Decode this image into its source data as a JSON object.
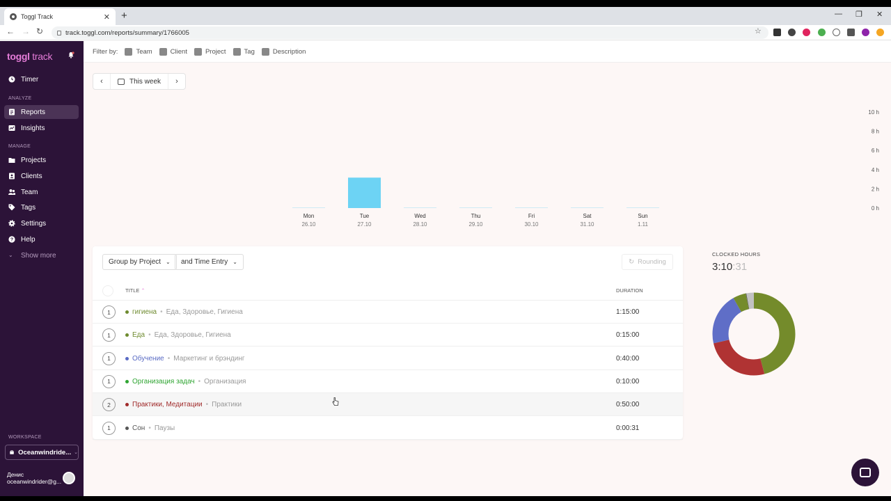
{
  "browser": {
    "tab_title": "Toggl Track",
    "url": "track.toggl.com/reports/summary/1766005"
  },
  "sidebar": {
    "logo_main": "toggl",
    "logo_sub": " track",
    "timer": "Timer",
    "analyze_label": "ANALYZE",
    "analyze": [
      "Reports",
      "Insights"
    ],
    "manage_label": "MANAGE",
    "manage": [
      "Projects",
      "Clients",
      "Team",
      "Tags",
      "Settings",
      "Help"
    ],
    "show_more": "Show more",
    "workspace_label": "WORKSPACE",
    "workspace": "Oceanwindride...",
    "user_name": "Денис",
    "user_email": "oceanwindrider@g..."
  },
  "filters": {
    "label": "Filter by:",
    "items": [
      "Team",
      "Client",
      "Project",
      "Tag",
      "Description"
    ]
  },
  "date_picker": {
    "label": "This week"
  },
  "chart_data": {
    "type": "bar",
    "categories": [
      "Mon",
      "Tue",
      "Wed",
      "Thu",
      "Fri",
      "Sat",
      "Sun"
    ],
    "dates": [
      "26.10",
      "27.10",
      "28.10",
      "29.10",
      "30.10",
      "31.10",
      "1.11"
    ],
    "values": [
      0,
      3.17,
      0,
      0,
      0,
      0,
      0
    ],
    "y_ticks": [
      "10 h",
      "8 h",
      "6 h",
      "4 h",
      "2 h",
      "0 h"
    ],
    "ylim": [
      0,
      10
    ],
    "bar_color": "#6dd3f4"
  },
  "table": {
    "group_by": "Group by Project",
    "sub_group": "and Time Entry",
    "rounding": "Rounding",
    "col_title": "TITLE",
    "col_duration": "DURATION",
    "rows": [
      {
        "count": "1",
        "project": "гигиена",
        "client": "Еда, Здоровье, Гигиена",
        "duration": "1:15:00",
        "color": "#6e8b2f"
      },
      {
        "count": "1",
        "project": "Еда",
        "client": "Еда, Здоровье, Гигиена",
        "duration": "0:15:00",
        "color": "#6e8b2f"
      },
      {
        "count": "1",
        "project": "Обучение",
        "client": "Маркетинг и брэндинг",
        "duration": "0:40:00",
        "color": "#5a6bc4"
      },
      {
        "count": "1",
        "project": "Организация задач",
        "client": "Организация",
        "duration": "0:10:00",
        "color": "#2fa532"
      },
      {
        "count": "2",
        "project": "Практики, Медитации",
        "client": "Практики",
        "duration": "0:50:00",
        "color": "#a02a2a"
      },
      {
        "count": "1",
        "project": "Сон",
        "client": "Паузы",
        "duration": "0:00:31",
        "color": "#555555"
      }
    ]
  },
  "clocked": {
    "label": "CLOCKED HOURS",
    "hm": "3:10",
    "sec": ":31"
  },
  "donut": {
    "segments": [
      {
        "value": 90,
        "color": "#748b2b"
      },
      {
        "value": 50,
        "color": "#b03333"
      },
      {
        "value": 40,
        "color": "#5f6ec7"
      },
      {
        "value": 10,
        "color": "#748b2b"
      },
      {
        "value": 0.5,
        "color": "#555555"
      },
      {
        "value": 6,
        "color": "#c2c2c2"
      }
    ]
  }
}
